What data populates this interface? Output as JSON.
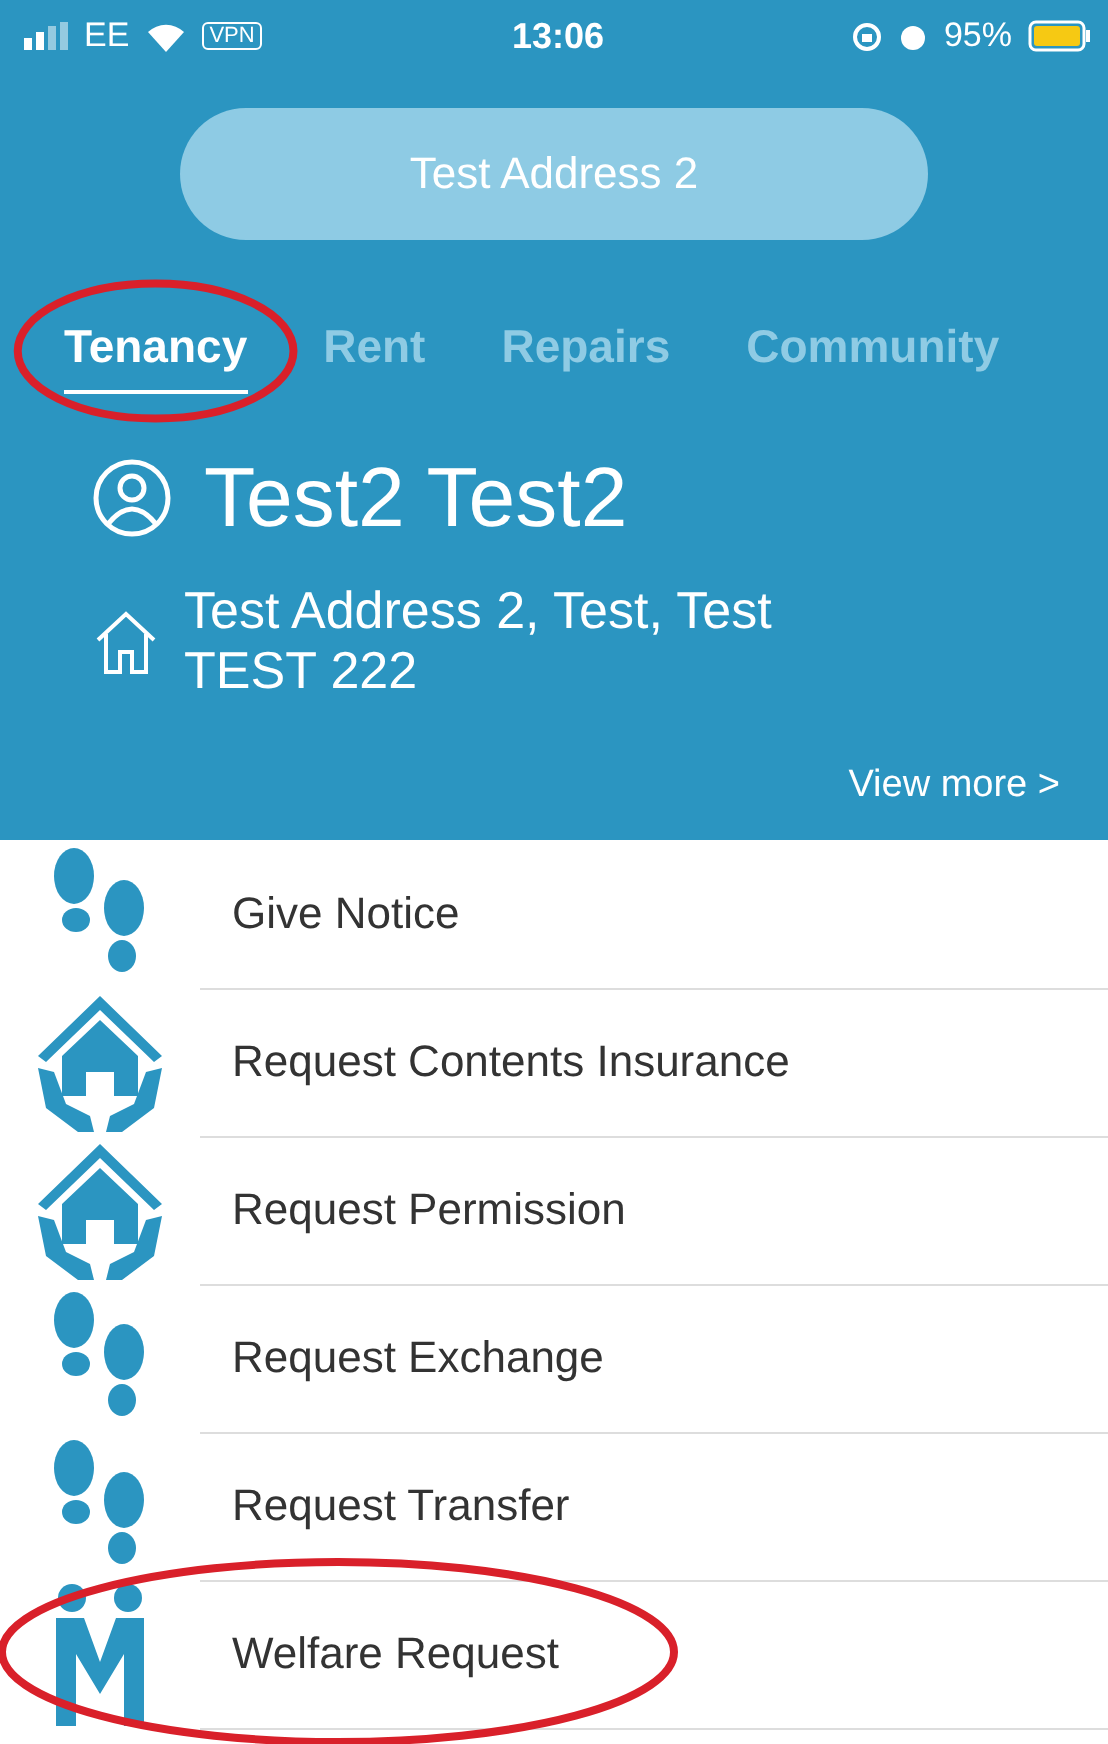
{
  "status_bar": {
    "carrier": "EE",
    "vpn": "VPN",
    "time": "13:06",
    "battery": "95%"
  },
  "property_button": "Test Address 2",
  "tabs": [
    {
      "label": "Tenancy",
      "selected": true,
      "circled": true
    },
    {
      "label": "Rent",
      "selected": false,
      "circled": false
    },
    {
      "label": "Repairs",
      "selected": false,
      "circled": false
    },
    {
      "label": "Community",
      "selected": false,
      "circled": false
    }
  ],
  "tenant": {
    "name": "Test2 Test2",
    "address": "Test Address 2, Test, Test\nTEST 222",
    "view_more": "View more >"
  },
  "actions": [
    {
      "label": "Give Notice",
      "kind": "feet",
      "circled": false
    },
    {
      "label": "Request Contents Insurance",
      "kind": "house",
      "circled": false
    },
    {
      "label": "Request Permission",
      "kind": "house",
      "circled": false
    },
    {
      "label": "Request Exchange",
      "kind": "feet",
      "circled": false
    },
    {
      "label": "Request Transfer",
      "kind": "feet",
      "circled": false
    },
    {
      "label": "Welfare Request",
      "kind": "people",
      "circled": true
    }
  ]
}
